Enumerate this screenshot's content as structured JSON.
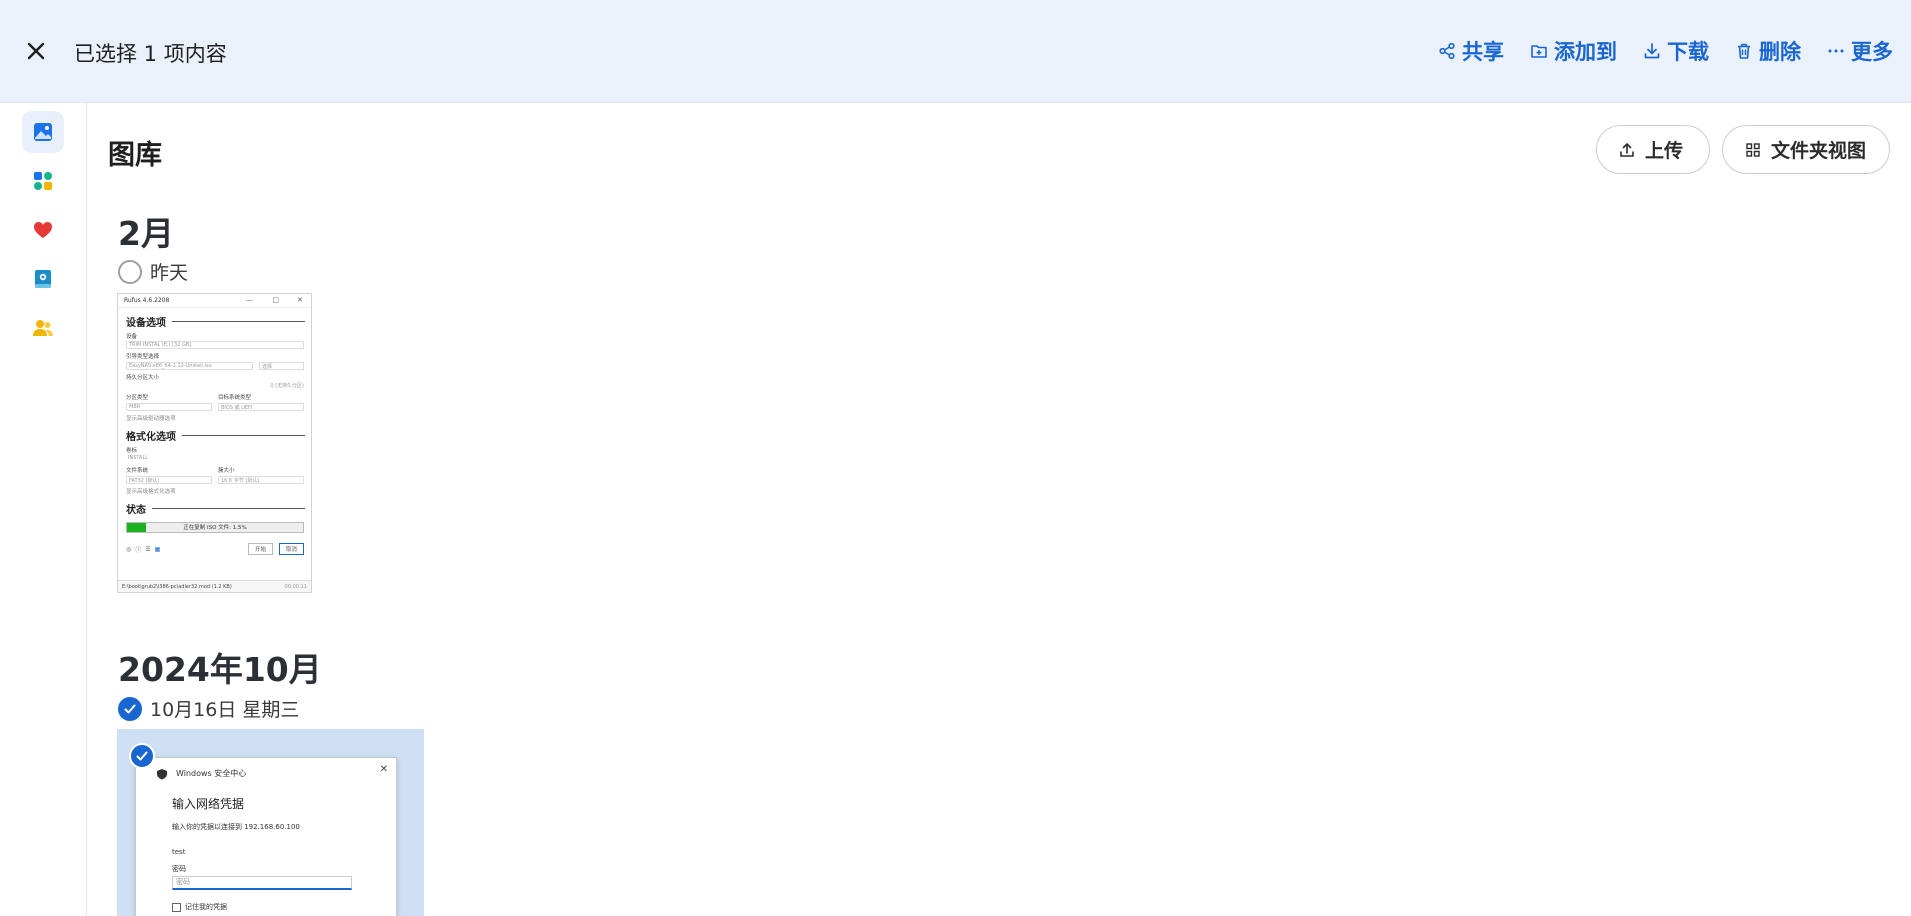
{
  "selection_bar": {
    "title": "已选择 1 项内容",
    "actions": [
      {
        "label": "共享",
        "icon": "share-icon"
      },
      {
        "label": "添加到",
        "icon": "add-to-icon"
      },
      {
        "label": "下载",
        "icon": "download-icon"
      },
      {
        "label": "删除",
        "icon": "trash-icon"
      },
      {
        "label": "更多",
        "icon": "more-icon"
      }
    ]
  },
  "sidebar": {
    "items": [
      {
        "icon": "image-icon",
        "active": true,
        "color": "#1a73e8"
      },
      {
        "icon": "apps-icon",
        "active": false
      },
      {
        "icon": "heart-icon",
        "active": false,
        "color": "#e53935"
      },
      {
        "icon": "album-icon",
        "active": false
      },
      {
        "icon": "people-icon",
        "active": false,
        "color": "#f5b400"
      }
    ]
  },
  "main": {
    "title": "图库",
    "upload_label": "上传",
    "folder_view_label": "文件夹视图",
    "groups": [
      {
        "month": "2月",
        "day": "昨天",
        "selected": false,
        "thumbnail": {
          "app_title": "Rufus 4.6.2208",
          "sec_device": "设备选项",
          "lbl_device": "设备",
          "val_device": "TRIM INSTAL (E:) [32 GB]",
          "lbl_boot": "引导类型选择",
          "val_boot": "EasyNAS.x86_64-1.12-Unstall.iso",
          "btn_select": "选择",
          "lbl_persist": "持久分区大小",
          "val_persist": "0 (无持久分区)",
          "lbl_part": "分区类型",
          "lbl_target": "目标系统类型",
          "val_part": "MBR",
          "val_target": "BIOS 或 UEFI",
          "adv_drive": "显示高级驱动器选项",
          "sec_format": "格式化选项",
          "lbl_vol": "卷标",
          "val_vol": "INSTALL",
          "lbl_fs": "文件系统",
          "lbl_cluster": "簇大小",
          "val_fs": "FAT32 (默认)",
          "val_cluster": "16 K 字节 (默认)",
          "adv_format": "显示高级格式化选项",
          "sec_status": "状态",
          "progress_text": "正在复制 ISO 文件: 1.5%",
          "progress": 0.11,
          "btn_start": "开始",
          "btn_cancel": "取消",
          "status_path": "E:\\boot\\grub2\\i386-pc\\adler32.mod (1.2 KB)",
          "status_time": "00:00:11"
        }
      },
      {
        "month": "2024年10月",
        "day": "10月16日 星期三",
        "selected": true,
        "thumbnail": {
          "dialog_app": "Windows 安全中心",
          "dialog_title": "输入网络凭据",
          "dialog_sub": "输入你的凭据以连接到 192.168.60.100",
          "user": "test",
          "pw_label": "密码",
          "pw_placeholder": "密码",
          "remember": "记住我的凭据"
        }
      }
    ]
  }
}
